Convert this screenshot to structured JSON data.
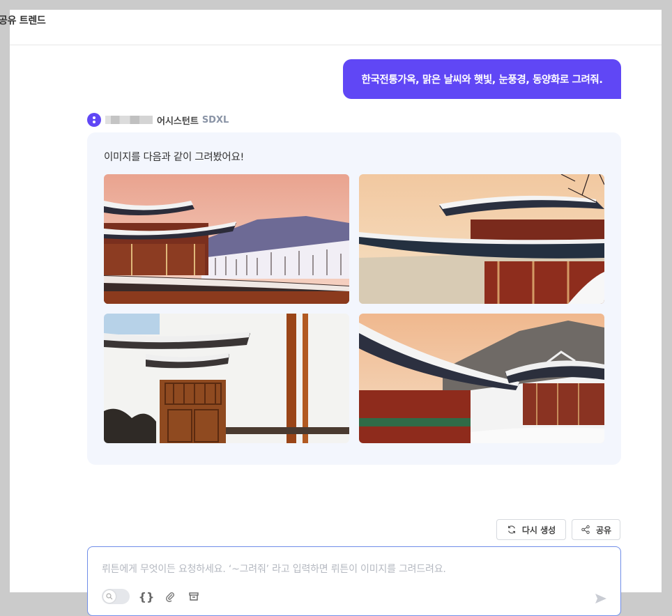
{
  "header": {
    "title": "공유 트렌드"
  },
  "conversation": {
    "user_message": "한국전통가옥, 맑은 날씨와 햇빛, 눈풍경, 동양화로 그려줘.",
    "assistant": {
      "name": "어시스턴트",
      "model": "SDXL",
      "response_text": "이미지를 다음과 같이 그려봤어요!",
      "images": [
        {
          "name": "hanok-image-1"
        },
        {
          "name": "hanok-image-2"
        },
        {
          "name": "hanok-image-3"
        },
        {
          "name": "hanok-image-4"
        }
      ]
    }
  },
  "actions": {
    "regenerate_label": "다시 생성",
    "share_label": "공유"
  },
  "composer": {
    "placeholder": "뤼튼에게 무엇이든 요청하세요.  ‘~그려줘’ 라고 입력하면 뤼튼이 이미지를 그려드려요.",
    "tool_icons": [
      "search-toggle-icon",
      "braces-icon",
      "paperclip-icon",
      "archive-icon",
      "send-icon"
    ]
  },
  "colors": {
    "accent": "#6047f5",
    "card_bg": "#f3f6fd",
    "input_border": "#6f8de8"
  }
}
